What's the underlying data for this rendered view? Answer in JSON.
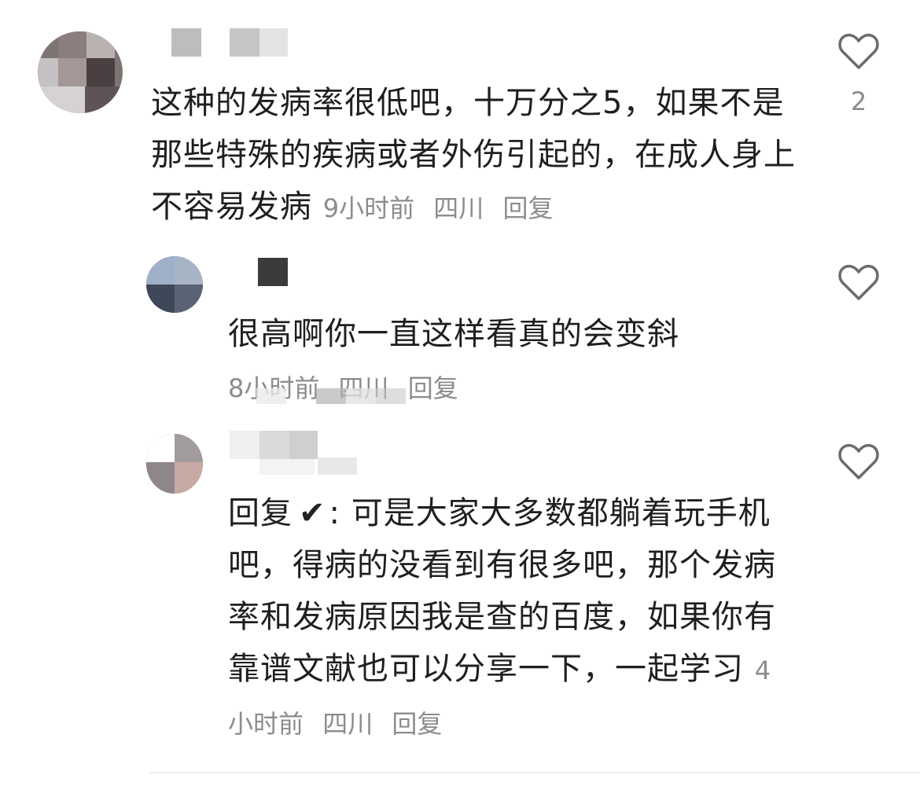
{
  "comments": [
    {
      "text": "这种的发病率很低吧，十万分之5，如果不是那些特殊的疾病或者外伤引起的，在成人身上不容易发病",
      "time": "9小时前",
      "location": "四川",
      "reply_label": "回复",
      "like_count": "2"
    },
    {
      "text": "很高啊你一直这样看真的会变斜",
      "time": "8小时前",
      "location": "四川",
      "reply_label": "回复"
    },
    {
      "reply_prefix": "回复",
      "check": "✔",
      "text": ": 可是大家大多数都躺着玩手机吧，得病的没看到有很多吧，那个发病率和发病原因我是查的百度，如果你有靠谱文献也可以分享一下，一起学习",
      "time": "4小时前",
      "location": "四川",
      "reply_label": "回复"
    }
  ],
  "colors": {
    "text": "#1f1f1f",
    "meta": "#8c8c8c"
  },
  "icons": [
    "heart-outline-icon"
  ]
}
